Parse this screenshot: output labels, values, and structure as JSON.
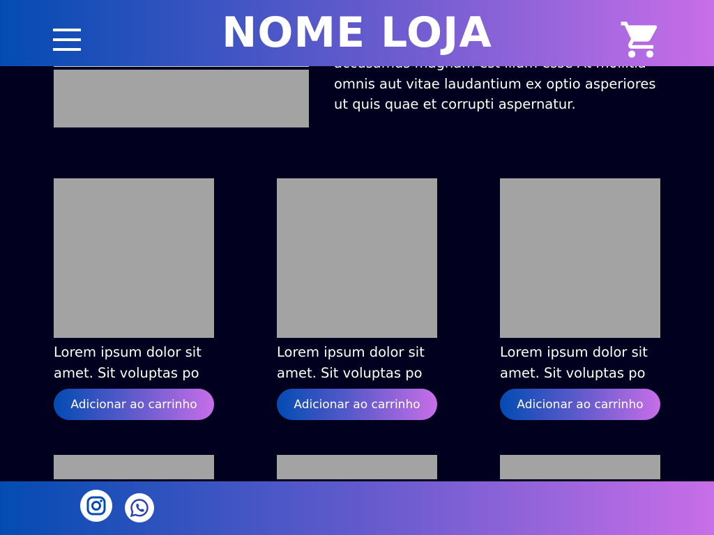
{
  "header": {
    "title": "NOME LOJA",
    "menu_icon": "hamburger-menu-icon",
    "cart_icon": "shopping-cart-icon"
  },
  "hero": {
    "text_lines": [
      "accusamus magnam est illum esse At mollitia",
      "omnis aut vitae laudantium ex optio asperiores",
      "ut quis quae et corrupti aspernatur."
    ]
  },
  "products": [
    {
      "desc_line1": "Lorem ipsum dolor sit",
      "desc_line2": "amet. Sit voluptas po",
      "button": "Adicionar ao carrinho"
    },
    {
      "desc_line1": "Lorem ipsum dolor sit",
      "desc_line2": "amet. Sit voluptas po",
      "button": "Adicionar ao carrinho"
    },
    {
      "desc_line1": "Lorem ipsum dolor sit",
      "desc_line2": "amet. Sit voluptas po",
      "button": "Adicionar ao carrinho"
    }
  ],
  "footer": {
    "social_icons": [
      "instagram-icon",
      "whatsapp-icon"
    ]
  },
  "colors": {
    "background": "#02001f",
    "gradient_start": "#034bb2",
    "gradient_end": "#c86ee8",
    "placeholder": "#a3a3a3"
  }
}
